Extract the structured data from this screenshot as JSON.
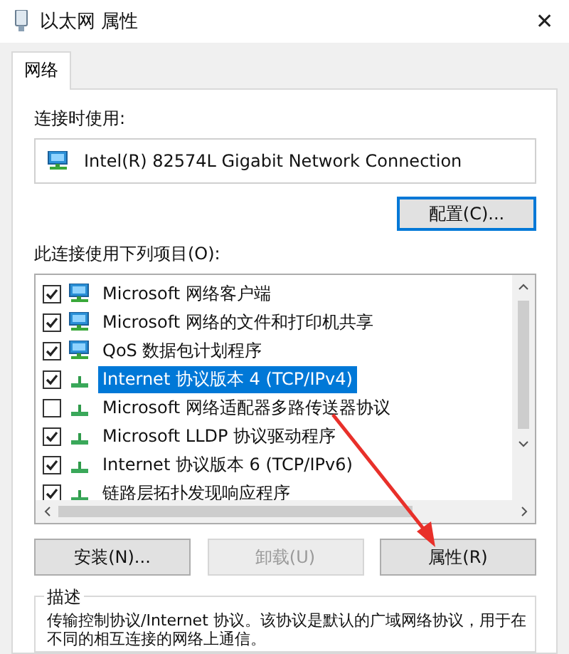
{
  "window": {
    "title": "以太网 属性",
    "close": "✕"
  },
  "tabs": [
    {
      "label": "网络",
      "selected": true
    }
  ],
  "connect_using": {
    "label": "连接时使用:",
    "adapter": "Intel(R) 82574L Gigabit Network Connection",
    "configure_button": "配置(C)..."
  },
  "items_label": "此连接使用下列项目(O):",
  "items": [
    {
      "kind": "service",
      "label": "Microsoft 网络客户端",
      "checked": true,
      "selected": false
    },
    {
      "kind": "service",
      "label": "Microsoft 网络的文件和打印机共享",
      "checked": true,
      "selected": false
    },
    {
      "kind": "service",
      "label": "QoS 数据包计划程序",
      "checked": true,
      "selected": false
    },
    {
      "kind": "protocol",
      "label": "Internet 协议版本 4 (TCP/IPv4)",
      "checked": true,
      "selected": true
    },
    {
      "kind": "protocol",
      "label": "Microsoft 网络适配器多路传送器协议",
      "checked": false,
      "selected": false
    },
    {
      "kind": "protocol",
      "label": "Microsoft LLDP 协议驱动程序",
      "checked": true,
      "selected": false
    },
    {
      "kind": "protocol",
      "label": "Internet 协议版本 6 (TCP/IPv6)",
      "checked": true,
      "selected": false
    },
    {
      "kind": "protocol",
      "label": "链路层拓扑发现响应程序",
      "checked": true,
      "selected": false
    }
  ],
  "buttons": [
    {
      "label": "安装(N)...",
      "disabled": false
    },
    {
      "label": "卸载(U)",
      "disabled": true
    },
    {
      "label": "属性(R)",
      "disabled": false
    }
  ],
  "description": {
    "title": "描述",
    "text": "传输控制协议/Internet 协议。该协议是默认的广域网络协议，用于在不同的相互连接的网络上通信。"
  }
}
